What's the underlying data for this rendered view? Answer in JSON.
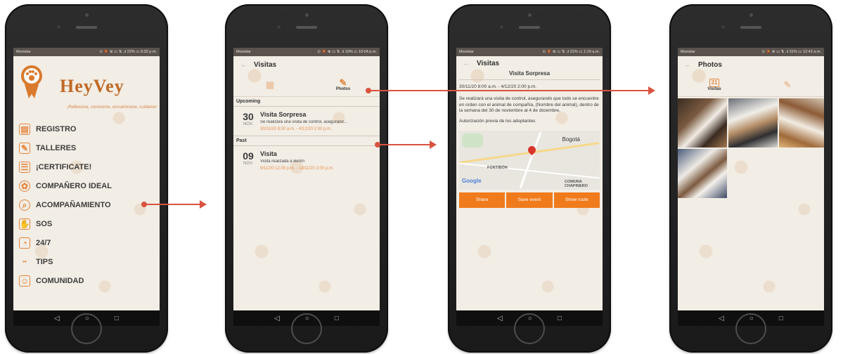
{
  "colors": {
    "accent": "#f07b1c",
    "brand": "#c06a27",
    "arrow": "#d9533f",
    "screen_bg": "#f2ede5"
  },
  "screens": {
    "home": {
      "status": {
        "carrier": "Movistar",
        "right": "⊙ 🔕 ⊗ ▭ ⇅ .ıl 22% ▭ 9:32 p.m."
      },
      "brand": "HeyVey",
      "tagline": "¡Reflexiona, conóceme, encuéntrame, cuídame!",
      "menu": [
        {
          "label": "REGISTRO",
          "icon": "id-card-icon"
        },
        {
          "label": "TALLERES",
          "icon": "notes-icon"
        },
        {
          "label": "¡CERTIFICATE!",
          "icon": "certificate-icon"
        },
        {
          "label": "COMPAÑERO IDEAL",
          "icon": "dog-face-icon"
        },
        {
          "label": "ACOMPAÑAMIENTO",
          "icon": "search-paw-icon"
        },
        {
          "label": "SOS",
          "icon": "sos-icon"
        },
        {
          "label": "24/7",
          "icon": "clock-hand-icon"
        },
        {
          "label": "TIPS",
          "icon": "tips-icon"
        },
        {
          "label": "COMUNIDAD",
          "icon": "community-icon"
        }
      ]
    },
    "visits": {
      "status": {
        "carrier": "Movistar",
        "right": "⊙ 🔕 ⊗ ▭ ⇅ .ıl 19% ▭ 10:04 p.m."
      },
      "title": "Visitas",
      "tab_photos": "Photos",
      "section_upcoming": "Upcoming",
      "section_past": "Past",
      "events": [
        {
          "day": "30",
          "month": "NOV.",
          "title": "Visita Sorpresa",
          "desc": "Se realizará una visita de control, asegurand...",
          "time": "30/11/20 8:00 a.m. - 4/12/20 2:00 p.m."
        },
        {
          "day": "09",
          "month": "NOV.",
          "title": "Visita",
          "desc": "Visita realizada a Berlín",
          "time": "9/11/20 12:00 p.m. - 13/11/20 2:00 p.m."
        }
      ]
    },
    "detail": {
      "status": {
        "carrier": "Movistar",
        "right": "⊙ 🔕 ⊗ ▭ ⇅ .ıl 31% ▭ 1:19 a.m."
      },
      "title": "Visitas",
      "event_title": "Visita Sorpresa",
      "range": "30/11/20 8:00 a.m. - 4/12/20 2:00 p.m.",
      "description": "Se realizará una visita de control, asegurando que todo se encuentre en orden con el animal de compañía, (Nombre del animal), dentro de la semana del 30 de noviembre al 4 de diciembre,",
      "authorization": "Autorización previa de los adoptantes",
      "map": {
        "city": "Bogotá",
        "district": "FONTIBÓN",
        "commune": "COMUNA CHAPINERO",
        "attribution": "Google"
      },
      "buttons": {
        "share": "Share",
        "save": "Save event",
        "route": "Show route"
      }
    },
    "photos": {
      "status": {
        "carrier": "Movistar",
        "right": "⊙ 🔕 ⊗ ▭ ⇅ .ıl 31% ▭ 12:42 a.m."
      },
      "title": "Photos",
      "tab_visits": "Visitas",
      "tab_calendar_day": "31",
      "photo_count": 4
    }
  },
  "nav": {
    "back": "◁",
    "home": "○",
    "recent": "□"
  }
}
